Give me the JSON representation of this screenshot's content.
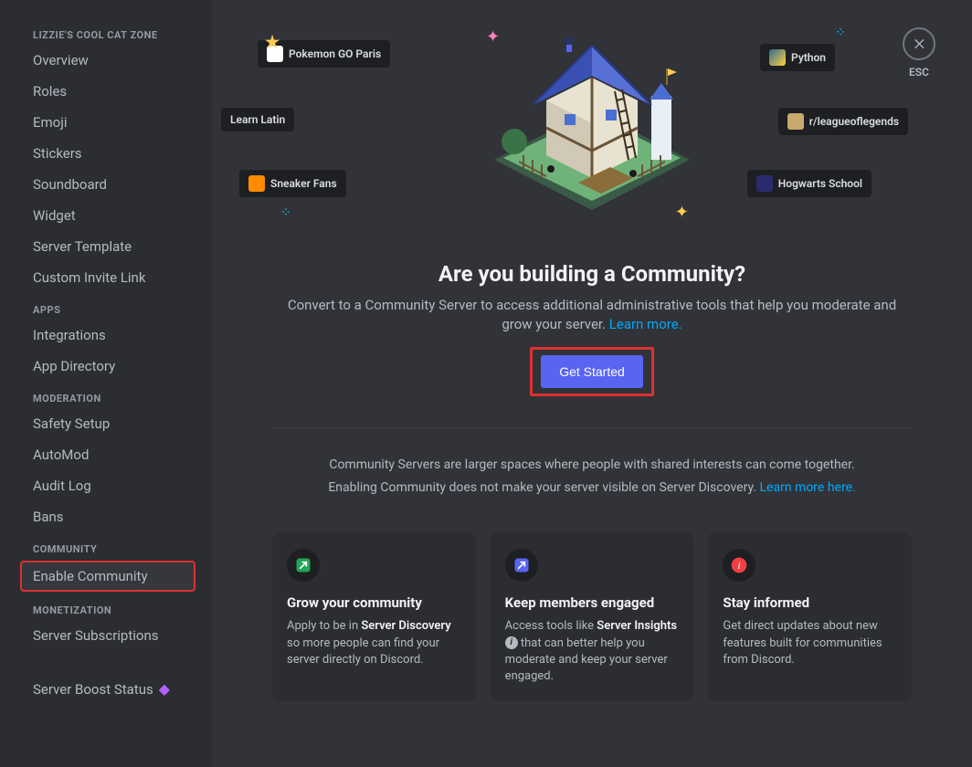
{
  "close": {
    "label": "ESC"
  },
  "sidebar": {
    "server_section": "LIZZIE'S COOL CAT ZONE",
    "server_items": [
      "Overview",
      "Roles",
      "Emoji",
      "Stickers",
      "Soundboard",
      "Widget",
      "Server Template",
      "Custom Invite Link"
    ],
    "apps_section": "APPS",
    "apps_items": [
      "Integrations",
      "App Directory"
    ],
    "moderation_section": "MODERATION",
    "moderation_items": [
      "Safety Setup",
      "AutoMod",
      "Audit Log",
      "Bans"
    ],
    "community_section": "COMMUNITY",
    "community_items": [
      "Enable Community"
    ],
    "monetization_section": "MONETIZATION",
    "monetization_items": [
      "Server Subscriptions"
    ],
    "boost_item": "Server Boost Status"
  },
  "chips": {
    "pokemon": "Pokemon GO Paris",
    "latin": "Learn Latin",
    "sneaker": "Sneaker Fans",
    "python": "Python",
    "lol": "r/leagueoflegends",
    "hogwarts": "Hogwarts School"
  },
  "heading": "Are you building a Community?",
  "subtext_pre": "Convert to a Community Server to access additional administrative tools that help you moderate and grow your server. ",
  "subtext_link": "Learn more.",
  "cta": "Get Started",
  "info_line1": "Community Servers are larger spaces where people with shared interests can come together.",
  "info_line2_pre": "Enabling Community does not make your server visible on Server Discovery. ",
  "info_line2_link": "Learn more here.",
  "cards": [
    {
      "title": "Grow your community",
      "body_pre": "Apply to be in ",
      "body_strong": "Server Discovery",
      "body_post": " so more people can find your server directly on Discord.",
      "icon_color": "#23a55a"
    },
    {
      "title": "Keep members engaged",
      "body_pre": "Access tools like ",
      "body_strong": "Server Insights",
      "body_info": true,
      "body_post": " that can better help you moderate and keep your server engaged.",
      "icon_color": "#5865f2"
    },
    {
      "title": "Stay informed",
      "body_pre": "",
      "body_strong": "",
      "body_post": "Get direct updates about new features built for communities from Discord.",
      "icon_color": "#f23f42"
    }
  ]
}
